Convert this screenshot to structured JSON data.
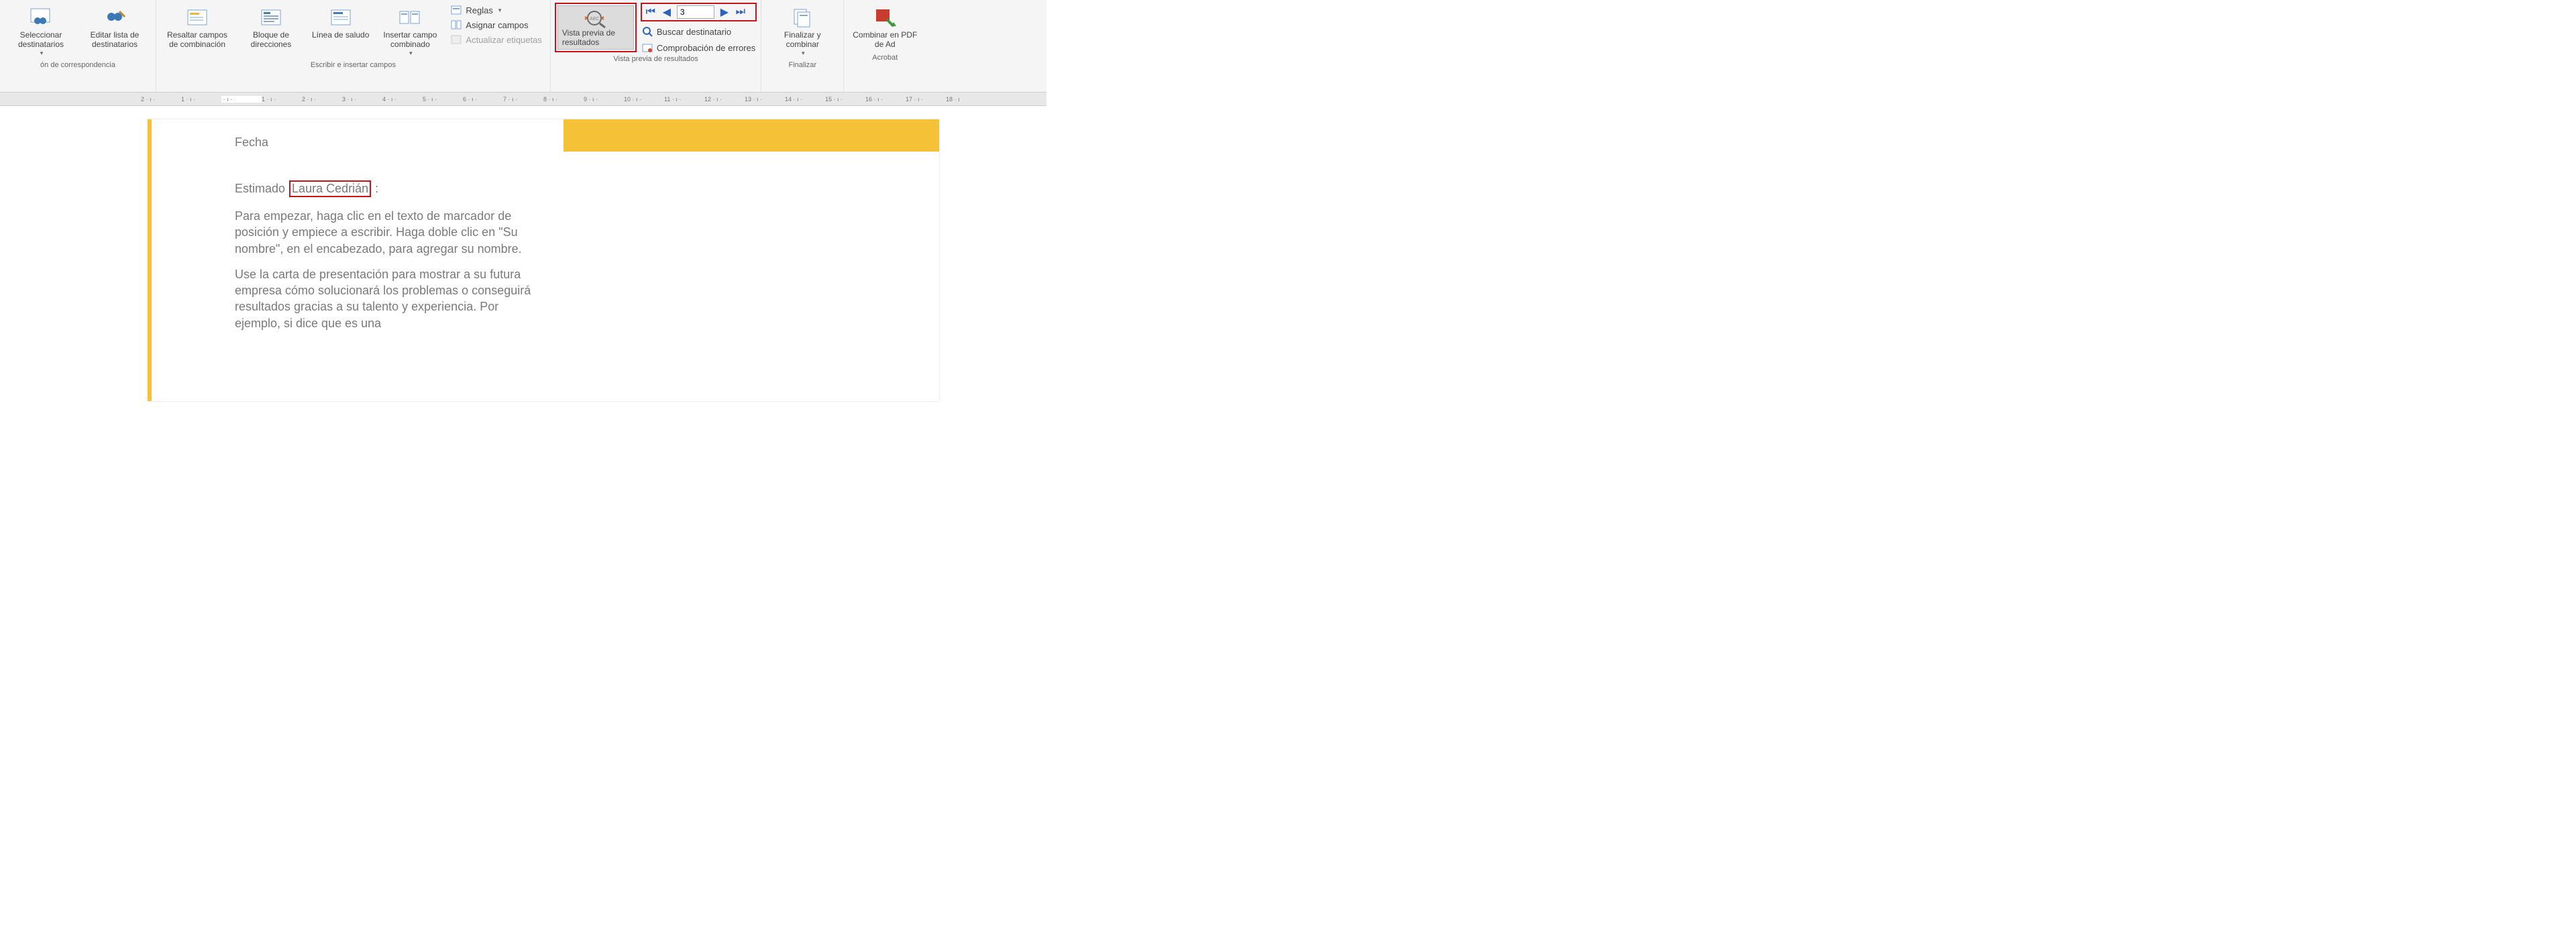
{
  "ribbon": {
    "group_start": {
      "select_recipients": "Seleccionar destinatarios",
      "edit_recipients": "Editar lista de destinatarios",
      "label": "ón de correspondencia"
    },
    "group_write": {
      "highlight_fields": "Resaltar campos de combinación",
      "address_block": "Bloque de direcciones",
      "greeting_line": "Línea de saludo",
      "insert_field": "Insertar campo combinado",
      "rules": "Reglas",
      "match_fields": "Asignar campos",
      "update_labels": "Actualizar etiquetas",
      "label": "Escribir e insertar campos"
    },
    "group_preview": {
      "preview_results": "Vista previa de resultados",
      "record_value": "3",
      "find_recipient": "Buscar destinatario",
      "check_errors": "Comprobación de errores",
      "label": "Vista previa de resultados"
    },
    "group_finish": {
      "finish_merge": "Finalizar y combinar",
      "label": "Finalizar"
    },
    "group_acrobat": {
      "merge_pdf": "Combinar en PDF de Ad",
      "label": "Acrobat"
    }
  },
  "ruler_ticks": [
    "2",
    "1",
    "",
    "1",
    "2",
    "3",
    "4",
    "5",
    "6",
    "7",
    "8",
    "9",
    "10",
    "11",
    "12",
    "13",
    "14",
    "15",
    "16",
    "17",
    "18"
  ],
  "document": {
    "date_label": "Fecha",
    "greeting_prefix": "Estimado",
    "greeting_name": "Laura Cedrián",
    "greeting_suffix": ":",
    "para1": "Para empezar, haga clic en el texto de marcador de posición y empiece a escribir. Haga doble clic en \"Su nombre\", en el encabezado, para agregar su nombre.",
    "para2": "Use la carta de presentación para mostrar a su futura empresa cómo solucionará los problemas o conseguirá resultados gracias a su talento y experiencia. Por ejemplo, si dice que es una"
  }
}
